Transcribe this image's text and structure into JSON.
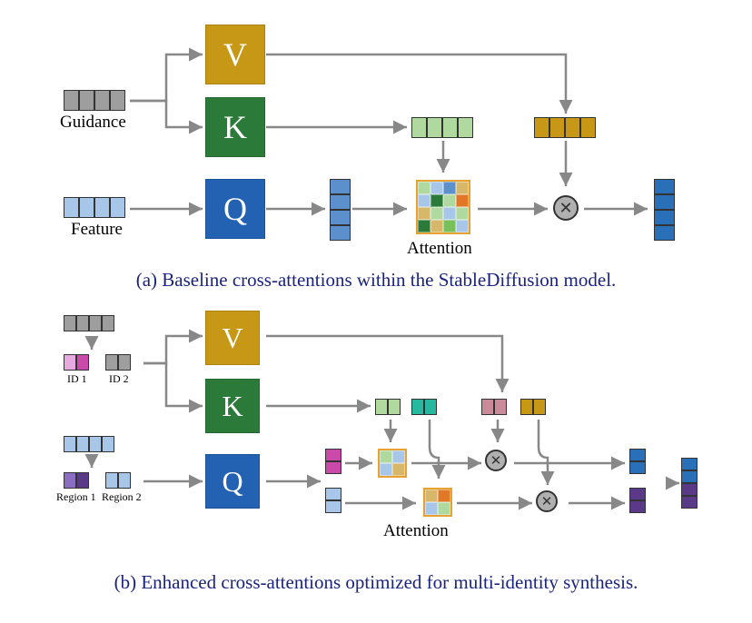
{
  "diagramA": {
    "caption": "(a) Baseline cross-attentions within the StableDiffusion model.",
    "labels": {
      "guidance": "Guidance",
      "feature": "Feature",
      "attention": "Attention",
      "V": "V",
      "K": "K",
      "Q": "Q"
    }
  },
  "diagramB": {
    "caption": "(b) Enhanced cross-attentions optimized for multi-identity synthesis.",
    "labels": {
      "id1": "ID 1",
      "id2": "ID 2",
      "region1": "Region 1",
      "region2": "Region 2",
      "attention": "Attention",
      "V": "V",
      "K": "K",
      "Q": "Q"
    }
  },
  "colors": {
    "Vbox": "#c79815",
    "Kbox": "#2c7a3a",
    "Qbox": "#2362b3",
    "grayCell": "#9e9e9e",
    "lightBlue": "#a8c7e8",
    "blue": "#5b90cc",
    "deepBlue": "#2a70b8",
    "lightGreen": "#b0d9a0",
    "green": "#78c05a",
    "teal": "#26b9a0",
    "brown": "#c79815",
    "lightBrown": "#d7b868",
    "rosy": "#c98a9a",
    "orange": "#e07828",
    "darkGreen": "#2c7a3a",
    "magenta": "#c94aa8",
    "pink": "#e8a8e0",
    "purple": "#5a3a88",
    "deepPurple": "#3a2a66",
    "attnBorder": "#e8a030"
  },
  "attentionGridA": [
    "#b0d9a0",
    "#a8c7e8",
    "#5b90cc",
    "#d7b868",
    "#a8c7e8",
    "#2c7a3a",
    "#b0d9a0",
    "#e07828",
    "#d7b868",
    "#b0d9a0",
    "#a8c7e8",
    "#b0d9a0",
    "#2c7a3a",
    "#d7b868",
    "#78c05a",
    "#a8c7e8"
  ],
  "attentionGridB1": [
    "#b0d9a0",
    "#a8c7e8",
    "#a8c7e8",
    "#d7b868"
  ],
  "attentionGridB2": [
    "#d7b868",
    "#e07828",
    "#a8c7e8",
    "#b0d9a0"
  ]
}
